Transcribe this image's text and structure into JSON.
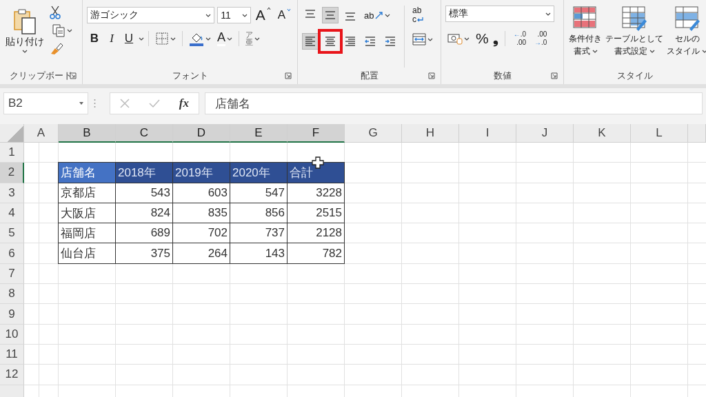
{
  "ribbon": {
    "clipboard": {
      "paste_label": "貼り付け",
      "group_label": "クリップボード"
    },
    "font": {
      "font_name": "游ゴシック",
      "font_size": "11",
      "grow": "A",
      "shrink": "A",
      "bold": "B",
      "italic": "I",
      "underline": "U",
      "font_color": "A",
      "phonetic_top": "ア",
      "phonetic_bottom": "亜",
      "group_label": "フォント"
    },
    "alignment": {
      "vertical_buttons": [
        {
          "kind": "top",
          "selected": false
        },
        {
          "kind": "middle",
          "selected": true
        },
        {
          "kind": "bottom",
          "selected": false
        }
      ],
      "orientation_label": "ab",
      "wrap_top": "ab",
      "wrap_bottom": "c",
      "horizontal_buttons": [
        {
          "kind": "left",
          "selected": true,
          "highlighted": false
        },
        {
          "kind": "center",
          "selected": false,
          "highlighted": true
        },
        {
          "kind": "right",
          "selected": false,
          "highlighted": false
        },
        {
          "kind": "indent-decrease",
          "selected": false,
          "highlighted": false
        },
        {
          "kind": "indent-increase",
          "selected": false,
          "highlighted": false
        }
      ],
      "group_label": "配置"
    },
    "number": {
      "format": "標準",
      "percent": "%",
      "comma": "❟",
      "increase_decimal": [
        "←",
        ".0",
        ".00"
      ],
      "decrease_decimal": [
        "→",
        ".00",
        ".0"
      ],
      "group_label": "数値"
    },
    "styles": {
      "buttons": [
        {
          "kind": "conditional",
          "lines": [
            "条件付き",
            "書式"
          ]
        },
        {
          "kind": "table",
          "lines": [
            "テーブルとして",
            "書式設定"
          ]
        },
        {
          "kind": "cell",
          "lines": [
            "セルの",
            "スタイル"
          ]
        }
      ],
      "group_label": "スタイル"
    }
  },
  "formula_bar": {
    "name_box": "B2",
    "fx": "fx",
    "formula": "店舗名"
  },
  "sheet": {
    "columns": [
      {
        "label": "A",
        "selected": false
      },
      {
        "label": "B",
        "selected": true
      },
      {
        "label": "C",
        "selected": true
      },
      {
        "label": "D",
        "selected": true
      },
      {
        "label": "E",
        "selected": true
      },
      {
        "label": "F",
        "selected": true
      },
      {
        "label": "G",
        "selected": false
      },
      {
        "label": "H",
        "selected": false
      },
      {
        "label": "I",
        "selected": false
      },
      {
        "label": "J",
        "selected": false
      },
      {
        "label": "K",
        "selected": false
      },
      {
        "label": "L",
        "selected": false
      }
    ],
    "rows": [
      {
        "label": "1",
        "selected": false
      },
      {
        "label": "2",
        "selected": true
      },
      {
        "label": "3",
        "selected": false
      },
      {
        "label": "4",
        "selected": false
      },
      {
        "label": "5",
        "selected": false
      },
      {
        "label": "6",
        "selected": false
      },
      {
        "label": "7",
        "selected": false
      },
      {
        "label": "8",
        "selected": false
      },
      {
        "label": "9",
        "selected": false
      },
      {
        "label": "10",
        "selected": false
      },
      {
        "label": "11",
        "selected": false
      },
      {
        "label": "12",
        "selected": false
      }
    ],
    "table": [
      {
        "kind": "header",
        "selected": true,
        "cells": [
          "店舗名",
          "2018年",
          "2019年",
          "2020年",
          "合計"
        ]
      },
      {
        "kind": "data",
        "selected": false,
        "cells": [
          "京都店",
          "543",
          "603",
          "547",
          "3228"
        ]
      },
      {
        "kind": "data",
        "selected": false,
        "cells": [
          "大阪店",
          "824",
          "835",
          "856",
          "2515"
        ]
      },
      {
        "kind": "data",
        "selected": false,
        "cells": [
          "福岡店",
          "689",
          "702",
          "737",
          "2128"
        ]
      },
      {
        "kind": "data",
        "selected": false,
        "cells": [
          "仙台店",
          "375",
          "264",
          "143",
          "782"
        ]
      }
    ]
  }
}
